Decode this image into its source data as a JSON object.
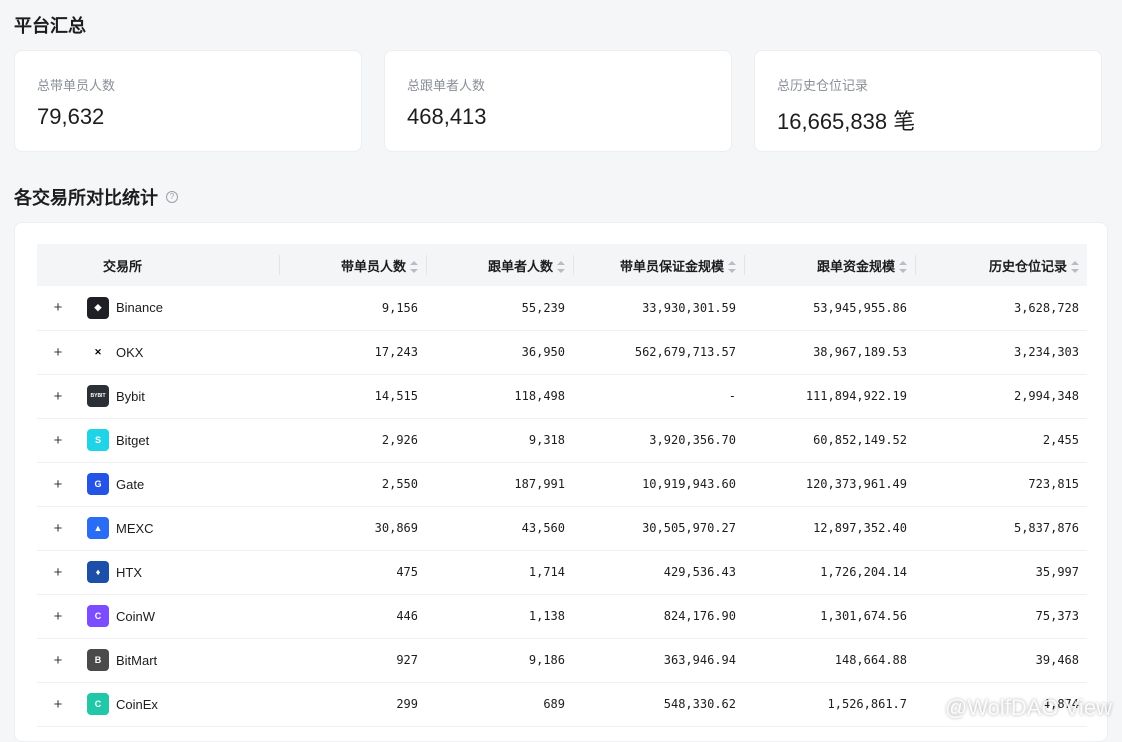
{
  "summary": {
    "title": "平台汇总",
    "cards": [
      {
        "label": "总带单员人数",
        "value": "79,632"
      },
      {
        "label": "总跟单者人数",
        "value": "468,413"
      },
      {
        "label": "总历史仓位记录",
        "value": "16,665,838 笔"
      }
    ]
  },
  "comparison": {
    "title": "各交易所对比统计",
    "help_icon": "question-circle-icon",
    "columns": [
      "交易所",
      "带单员人数",
      "跟单者人数",
      "带单员保证金规模",
      "跟单资金规模",
      "历史仓位记录"
    ],
    "rows": [
      {
        "expand": "+",
        "exchange": "Binance",
        "logo_color": "#1e2026",
        "logo_glyph": "◆",
        "leaders": "9,156",
        "followers": "55,239",
        "leader_margin": "33,930,301.59",
        "follower_funds": "53,945,955.86",
        "history": "3,628,728"
      },
      {
        "expand": "+",
        "exchange": "OKX",
        "logo_color": "#ffffff",
        "logo_glyph": "✕",
        "leaders": "17,243",
        "followers": "36,950",
        "leader_margin": "562,679,713.57",
        "follower_funds": "38,967,189.53",
        "history": "3,234,303"
      },
      {
        "expand": "+",
        "exchange": "Bybit",
        "logo_color": "#2b2f36",
        "logo_glyph": "BYBIT",
        "leaders": "14,515",
        "followers": "118,498",
        "leader_margin": "-",
        "follower_funds": "111,894,922.19",
        "history": "2,994,348"
      },
      {
        "expand": "+",
        "exchange": "Bitget",
        "logo_color": "#1fd4e6",
        "logo_glyph": "S",
        "leaders": "2,926",
        "followers": "9,318",
        "leader_margin": "3,920,356.70",
        "follower_funds": "60,852,149.52",
        "history": "2,455"
      },
      {
        "expand": "+",
        "exchange": "Gate",
        "logo_color": "#2354e6",
        "logo_glyph": "G",
        "leaders": "2,550",
        "followers": "187,991",
        "leader_margin": "10,919,943.60",
        "follower_funds": "120,373,961.49",
        "history": "723,815"
      },
      {
        "expand": "+",
        "exchange": "MEXC",
        "logo_color": "#2a6df4",
        "logo_glyph": "▲",
        "leaders": "30,869",
        "followers": "43,560",
        "leader_margin": "30,505,970.27",
        "follower_funds": "12,897,352.40",
        "history": "5,837,876"
      },
      {
        "expand": "+",
        "exchange": "HTX",
        "logo_color": "#1b4fa8",
        "logo_glyph": "♦",
        "leaders": "475",
        "followers": "1,714",
        "leader_margin": "429,536.43",
        "follower_funds": "1,726,204.14",
        "history": "35,997"
      },
      {
        "expand": "+",
        "exchange": "CoinW",
        "logo_color": "#7b4dff",
        "logo_glyph": "C",
        "leaders": "446",
        "followers": "1,138",
        "leader_margin": "824,176.90",
        "follower_funds": "1,301,674.56",
        "history": "75,373"
      },
      {
        "expand": "+",
        "exchange": "BitMart",
        "logo_color": "#4a4a4a",
        "logo_glyph": "B",
        "leaders": "927",
        "followers": "9,186",
        "leader_margin": "363,946.94",
        "follower_funds": "148,664.88",
        "history": "39,468"
      },
      {
        "expand": "+",
        "exchange": "CoinEx",
        "logo_color": "#20c8a8",
        "logo_glyph": "C",
        "leaders": "299",
        "followers": "689",
        "leader_margin": "548,330.62",
        "follower_funds": "1,526,861.7",
        "history": "4,874"
      }
    ]
  },
  "watermark": "@WolfDAO View"
}
